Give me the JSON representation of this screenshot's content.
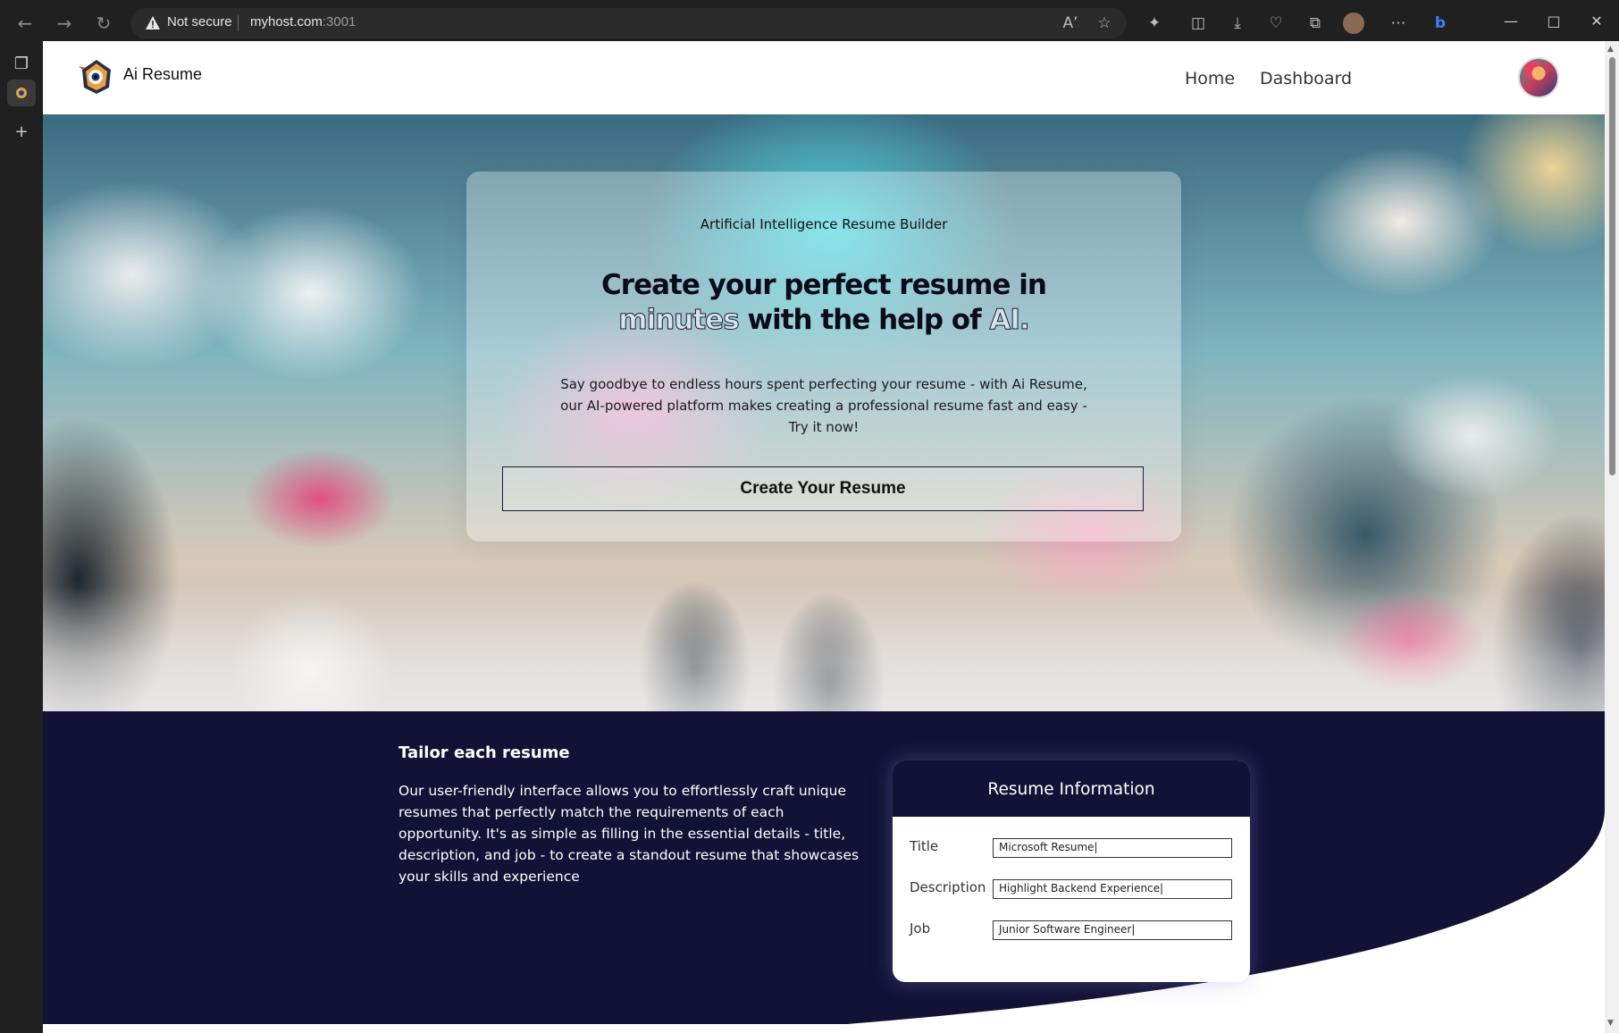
{
  "browser": {
    "security_label": "Not secure",
    "url_host": "myhost.com",
    "url_port": ":3001"
  },
  "site": {
    "brand": "Ai Resume",
    "nav": [
      {
        "label": "Home"
      },
      {
        "label": "Dashboard"
      }
    ]
  },
  "hero": {
    "eyebrow": "Artificial Intelligence Resume Builder",
    "title_part1": "Create your perfect resume in ",
    "title_highlight1": "minutes",
    "title_part2": " with the help of ",
    "title_highlight2": "AI.",
    "description": "Say goodbye to endless hours spent perfecting your resume - with Ai Resume, our AI-powered platform makes creating a professional resume fast and easy - Try it now!",
    "cta_label": "Create Your Resume"
  },
  "feature": {
    "title": "Tailor each resume",
    "text": "Our user-friendly interface allows you to effortlessly craft unique resumes that perfectly match the requirements of each opportunity. It's as simple as filling in the essential details - title, description, and job - to create a standout resume that showcases your skills and experience",
    "card": {
      "heading": "Resume Information",
      "fields": [
        {
          "label": "Title",
          "value": "Microsoft Resume|"
        },
        {
          "label": "Description",
          "value": "Highlight Backend Experience|"
        },
        {
          "label": "Job",
          "value": "Junior Software Engineer|"
        }
      ]
    }
  },
  "colors": {
    "section_bg": "#121236",
    "browser_frame": "#202020"
  },
  "icons": {
    "toolbar": [
      "back-icon",
      "forward-icon",
      "refresh-icon",
      "read-aloud-icon",
      "favorite-star-icon",
      "extensions-icon",
      "split-screen-icon",
      "downloads-icon",
      "health-icon",
      "collections-icon",
      "profile-icon",
      "more-icon",
      "bing-icon"
    ]
  }
}
